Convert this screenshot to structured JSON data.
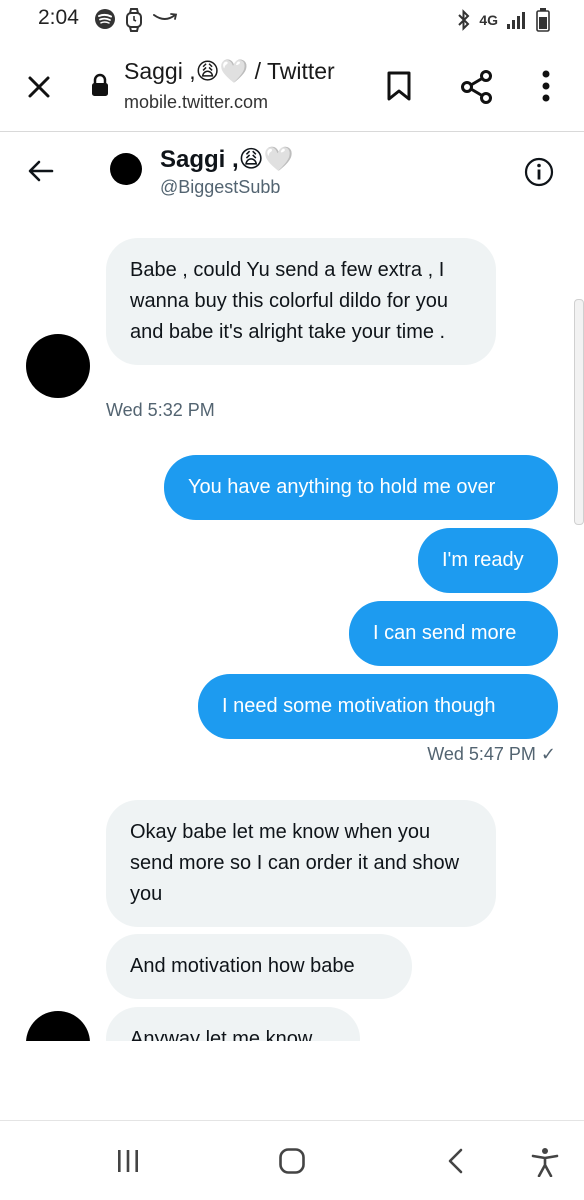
{
  "status_bar": {
    "time": "2:04",
    "network": "4G",
    "icons": [
      "spotify-icon",
      "watch-icon",
      "amazon-icon",
      "bluetooth-icon",
      "signal-icon",
      "battery-icon"
    ]
  },
  "browser": {
    "page_title": "Saggi ,😩🤍 / Twitter",
    "url": "mobile.twitter.com",
    "icons": [
      "close-icon",
      "lock-icon",
      "bookmark-icon",
      "share-icon",
      "more-vertical-icon"
    ]
  },
  "conversation": {
    "name": "Saggi ,😩🤍",
    "handle": "@BiggestSubb",
    "icons": [
      "back-arrow-icon",
      "info-icon"
    ]
  },
  "messages": [
    {
      "direction": "incoming",
      "text": "Babe , could Yu send a few extra , I wanna buy this colorful dildo for you and babe it's alright take your time ."
    },
    {
      "direction": "outgoing",
      "text": "You have anything to hold me over"
    },
    {
      "direction": "outgoing",
      "text": "I'm ready"
    },
    {
      "direction": "outgoing",
      "text": "I can send more"
    },
    {
      "direction": "outgoing",
      "text": "I need some motivation though"
    },
    {
      "direction": "incoming",
      "text": "Okay babe let me know when you send more so I can order it and show you"
    },
    {
      "direction": "incoming",
      "text": "And motivation how babe"
    },
    {
      "direction": "incoming",
      "text": "Anyway let me know"
    }
  ],
  "timestamps": {
    "first": "Wed 5:32 PM",
    "second": "Wed 5:47 PM ✓"
  },
  "nav_bar": {
    "icons": [
      "recent-apps-icon",
      "home-icon",
      "back-icon",
      "accessibility-icon"
    ]
  },
  "colors": {
    "outgoing_bubble": "#1d9bf0",
    "incoming_bubble": "#eff3f4",
    "secondary_text": "#536471"
  }
}
